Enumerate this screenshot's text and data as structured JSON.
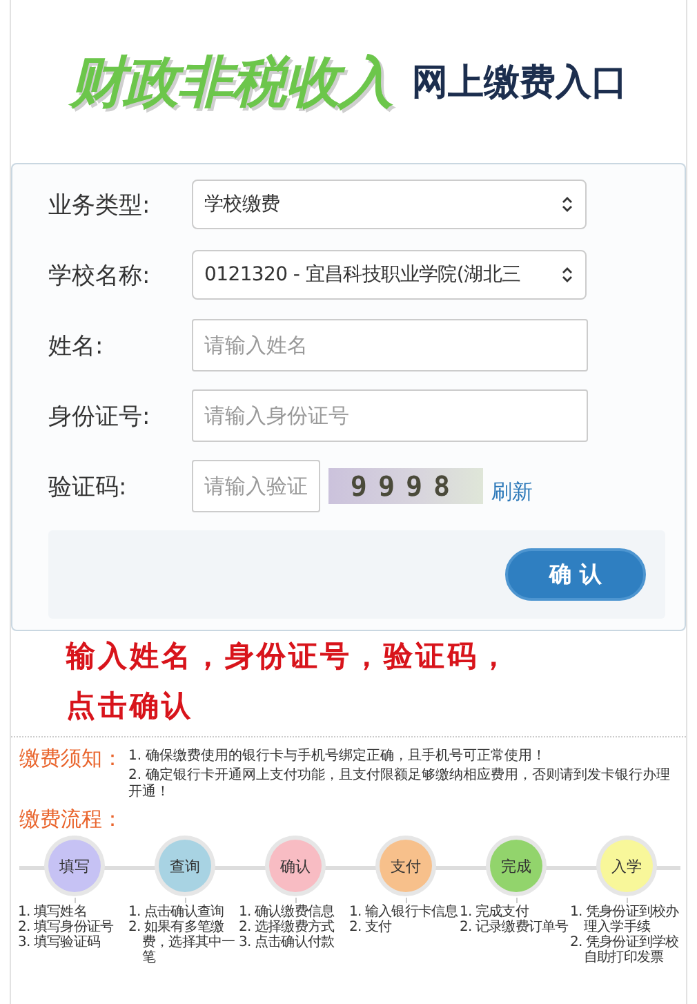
{
  "header": {
    "logo": "财政非税收入",
    "subtitle": "网上缴费入口"
  },
  "form": {
    "fields": [
      {
        "kind": "select",
        "label": "业务类型:",
        "value": "学校缴费"
      },
      {
        "kind": "select",
        "label": "学校名称:",
        "value": "0121320 - 宜昌科技职业学院(湖北三"
      },
      {
        "kind": "input",
        "label": "姓名:",
        "placeholder": "请输入姓名"
      },
      {
        "kind": "input",
        "label": "身份证号:",
        "placeholder": "请输入身份证号"
      },
      {
        "kind": "captcha",
        "label": "验证码:",
        "placeholder": "请输入验证",
        "code": "9998",
        "refresh": "刷新"
      }
    ],
    "submit": "确 认"
  },
  "annotation": "输入姓名，身份证号，验证码，点击确认",
  "notice": {
    "title": "缴费须知：",
    "items": [
      "1. 确保缴费使用的银行卡与手机号绑定正确，且手机号可正常使用！",
      "2. 确定银行卡开通网上支付功能，且支付限额足够缴纳相应费用，否则请到发卡银行办理开通！"
    ]
  },
  "process": {
    "title": "缴费流程：",
    "steps": [
      {
        "name": "填写",
        "color": "#c6c2f4",
        "items": [
          "1. 填写姓名",
          "2. 填写身份证号",
          "3. 填写验证码"
        ]
      },
      {
        "name": "查询",
        "color": "#a8d3e3",
        "items": [
          "1. 点击确认查询",
          "2. 如果有多笔缴费，选择其中一笔"
        ]
      },
      {
        "name": "确认",
        "color": "#f8bcc3",
        "items": [
          "1. 确认缴费信息",
          "2. 选择缴费方式",
          "3. 点击确认付款"
        ]
      },
      {
        "name": "支付",
        "color": "#f7c08b",
        "items": [
          "1. 输入银行卡信息",
          "2. 支付"
        ]
      },
      {
        "name": "完成",
        "color": "#92d46c",
        "items": [
          "1. 完成支付",
          "2. 记录缴费订单号"
        ]
      },
      {
        "name": "入学",
        "color": "#f8f79a",
        "items": [
          "1. 凭身份证到校办理入学手续",
          "2. 凭身份证到学校自助打印发票"
        ]
      }
    ]
  }
}
